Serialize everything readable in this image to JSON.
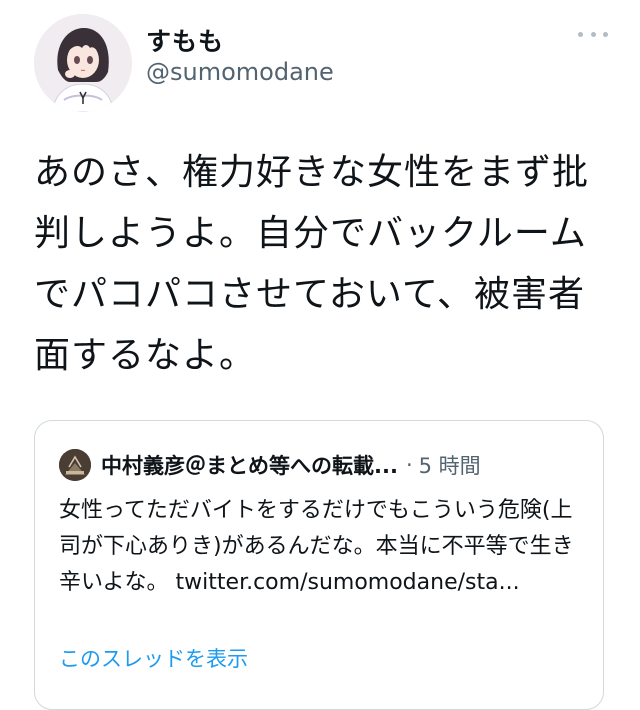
{
  "user": {
    "display_name": "すもも",
    "handle": "@sumomodane"
  },
  "tweet": {
    "text": "あのさ、権力好きな女性をまず批判しようよ。自分でバックルームでパコパコさせておいて、被害者面するなよ。"
  },
  "quote": {
    "author": "中村義彦＠まとめ等への転載...",
    "separator": "·",
    "time": "5 時間",
    "text": "女性ってただバイトをするだけでもこういう危険(上司が下心ありき)があるんだな。本当に不平等で生き辛いよな。 twitter.com/sumomodane/sta...",
    "show_thread": "このスレッドを表示"
  },
  "icons": {
    "more": "more-horizontal-icon"
  },
  "colors": {
    "text": "#0f1419",
    "secondary": "#536471",
    "link": "#1d9bf0",
    "border": "#cfd9de"
  }
}
